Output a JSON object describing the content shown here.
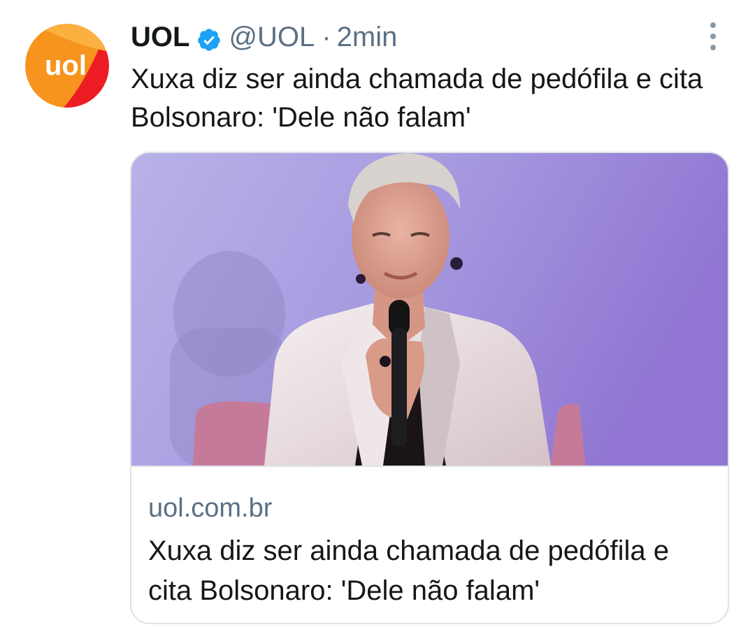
{
  "tweet": {
    "author": {
      "display_name": "UOL",
      "handle": "@UOL",
      "verified": true,
      "avatar_icon": "uol-logo-avatar",
      "avatar_text": "uol"
    },
    "separator": "·",
    "time": "2min",
    "text": "Xuxa diz ser ainda chamada de pedófila e cita Bolsonaro: 'Dele não falam'",
    "more_icon": "more-vertical-icon",
    "card": {
      "image_icon": "article-photo",
      "domain": "uol.com.br",
      "title": "Xuxa diz ser ainda chamada de pedófila e cita Bolsonaro: 'Dele não falam'"
    }
  },
  "colors": {
    "verified_badge": "#1da1f2",
    "secondary_text": "#5b7083",
    "border": "#dde3e8",
    "uol_orange": "#f7941d",
    "uol_red": "#ed1c24"
  }
}
